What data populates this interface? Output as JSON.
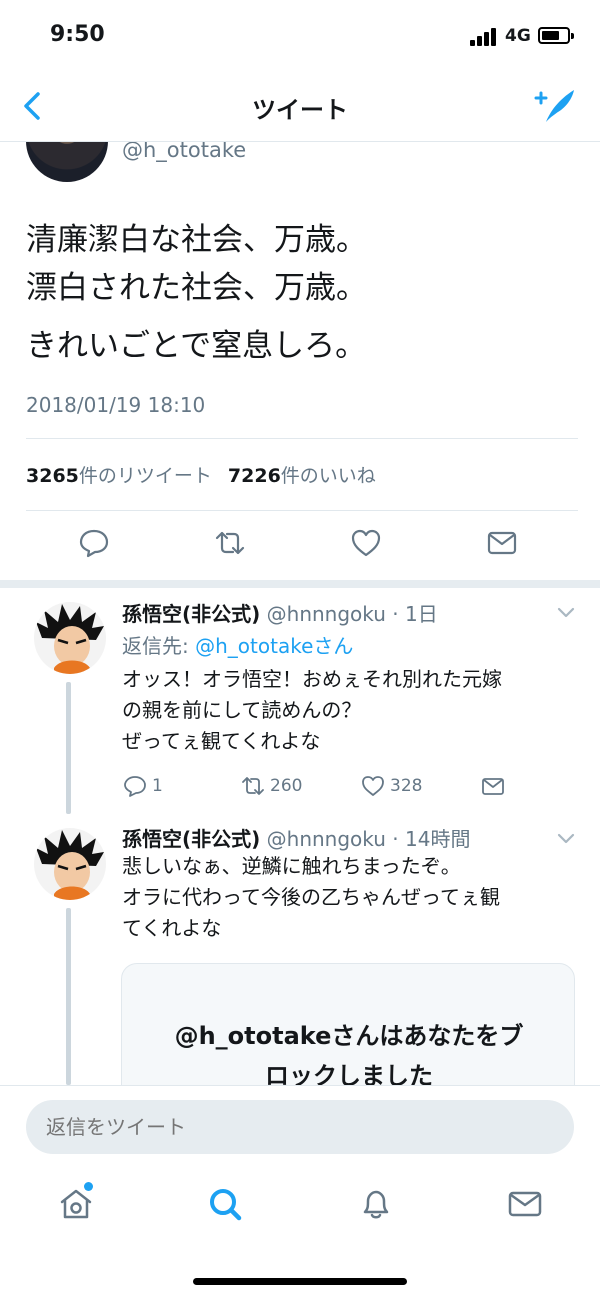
{
  "status_bar": {
    "time": "9:50",
    "network": "4G"
  },
  "nav": {
    "title": "ツイート"
  },
  "main_tweet": {
    "handle": "@h_ototake",
    "lines": [
      "清廉潔白な社会、万歳。",
      "漂白された社会、万歳。",
      "きれいごとで窒息しろ。"
    ],
    "date": "2018/01/19 18:10",
    "retweet_count": "3265",
    "retweet_label": "件のリツイート",
    "like_count": "7226",
    "like_label": "件のいいね"
  },
  "replies": [
    {
      "name": "孫悟空(非公式)",
      "meta": "@hnnngoku · 1日",
      "reply_to_label": "返信先: ",
      "reply_to_handle": "@h_ototakeさん",
      "lines": [
        "オッス！オラ悟空！おめぇそれ別れた元嫁",
        "の親を前にして読めんの？",
        "ぜってぇ観てくれよな"
      ],
      "reply_count": "1",
      "retweet_count": "260",
      "like_count": "328"
    },
    {
      "name": "孫悟空(非公式)",
      "meta": "@hnnngoku · 14時間",
      "lines": [
        "悲しいなぁ、逆鱗に触れちまったぞ。",
        "オラに代わって今後の乙ちゃんぜってぇ観",
        "てくれよな"
      ],
      "blocked_line1": "@h_ototakeさんはあなたをブ",
      "blocked_line2": "ロックしました"
    }
  ],
  "composer": {
    "placeholder": "返信をツイート"
  },
  "colors": {
    "accent": "#1da1f2",
    "muted": "#657786",
    "text": "#14171a"
  }
}
